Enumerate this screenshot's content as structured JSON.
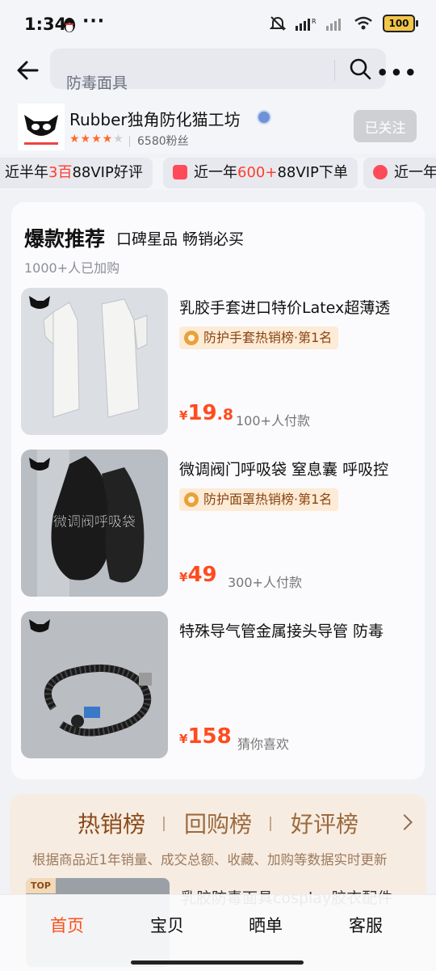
{
  "status": {
    "time": "1:34",
    "dots": "···",
    "battery": "100"
  },
  "search": {
    "placeholder": "防毒面具"
  },
  "shop": {
    "name": "Rubber独角防化猫工坊",
    "rating_stars": 4,
    "fans": "6580粉丝",
    "follow_label": "已关注"
  },
  "tags": [
    {
      "pre": "近半年",
      "hl": "3百",
      "post": "88VIP好评"
    },
    {
      "pre": "近一年",
      "hl": "600+",
      "post": "88VIP下单"
    },
    {
      "pre": "近一年",
      "hl": "",
      "post": ""
    }
  ],
  "hot": {
    "title": "爆款推荐",
    "subtitle": "口碑星品 畅销必买",
    "count": "1000+人已加购",
    "products": [
      {
        "title": "乳胶手套进口特价Latex超薄透",
        "rank": "防护手套热销榜·第1名",
        "currency": "¥",
        "price_int": "19",
        "price_dec": ".8",
        "paid": "100+人付款"
      },
      {
        "title": "微调阀门呼吸袋 窒息囊 呼吸控",
        "rank": "防护面罩热销榜·第1名",
        "currency": "¥",
        "price_int": "49",
        "price_dec": "",
        "paid": "300+人付款",
        "image_text": "微调阀呼吸袋"
      },
      {
        "title": "特殊导气管金属接头导管 防毒",
        "rank": "",
        "currency": "¥",
        "price_int": "158",
        "price_dec": "",
        "paid": "猜你喜欢"
      }
    ]
  },
  "ranking": {
    "tabs": [
      "热销榜",
      "回购榜",
      "好评榜"
    ],
    "description": "根据商品近1年销量、成交总额、收藏、加购等数据实时更新",
    "item_badge": "TOP",
    "item_title": "乳胶防毒面具cosplay胶衣配件"
  },
  "nav": {
    "items": [
      "首页",
      "宝贝",
      "晒单",
      "客服"
    ],
    "active_index": 0
  },
  "colors": {
    "accent": "#ff4f17",
    "price": "#ff4b1f",
    "highlight": "#ff3d2e"
  }
}
